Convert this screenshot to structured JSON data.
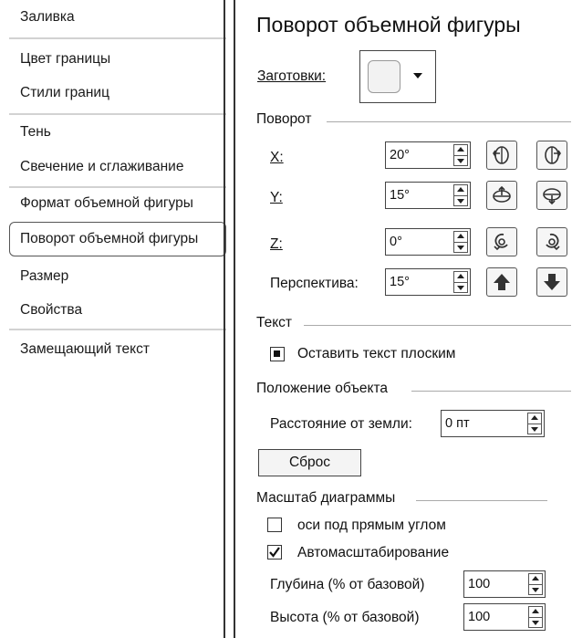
{
  "sidebar": {
    "items": [
      {
        "label": "Заливка"
      },
      {
        "label": "Цвет границы"
      },
      {
        "label": "Стили границ"
      },
      {
        "label": "Тень"
      },
      {
        "label": "Свечение и сглаживание"
      },
      {
        "label": "Формат объемной фигуры"
      },
      {
        "label": "Поворот объемной фигуры"
      },
      {
        "label": "Размер"
      },
      {
        "label": "Свойства"
      },
      {
        "label": "Замещающий текст"
      }
    ],
    "selected": "Поворот объемной фигуры"
  },
  "panel": {
    "title": "Поворот объемной фигуры",
    "presets_label": "Заготовки:",
    "rotation": {
      "group": "Поворот",
      "x_label": "X:",
      "x_value": "20°",
      "y_label": "Y:",
      "y_value": "15°",
      "z_label": "Z:",
      "z_value": "0°",
      "perspective_label": "Перспектива:",
      "perspective_value": "15°"
    },
    "text": {
      "group": "Текст",
      "keep_flat_label": "Оставить текст плоским",
      "keep_flat_checked": true
    },
    "position": {
      "group": "Положение объекта",
      "distance_label": "Расстояние от земли:",
      "distance_value": "0 пт"
    },
    "reset_label": "Сброс",
    "chart_scale": {
      "group": "Масштаб диаграммы",
      "right_angle_label": "оси под прямым углом",
      "right_angle_checked": false,
      "autoscale_label": "Автомасштабирование",
      "autoscale_checked": true,
      "depth_label": "Глубина (% от базовой)",
      "depth_value": "100",
      "height_label": "Высота (% от базовой)",
      "height_value": "100"
    }
  }
}
